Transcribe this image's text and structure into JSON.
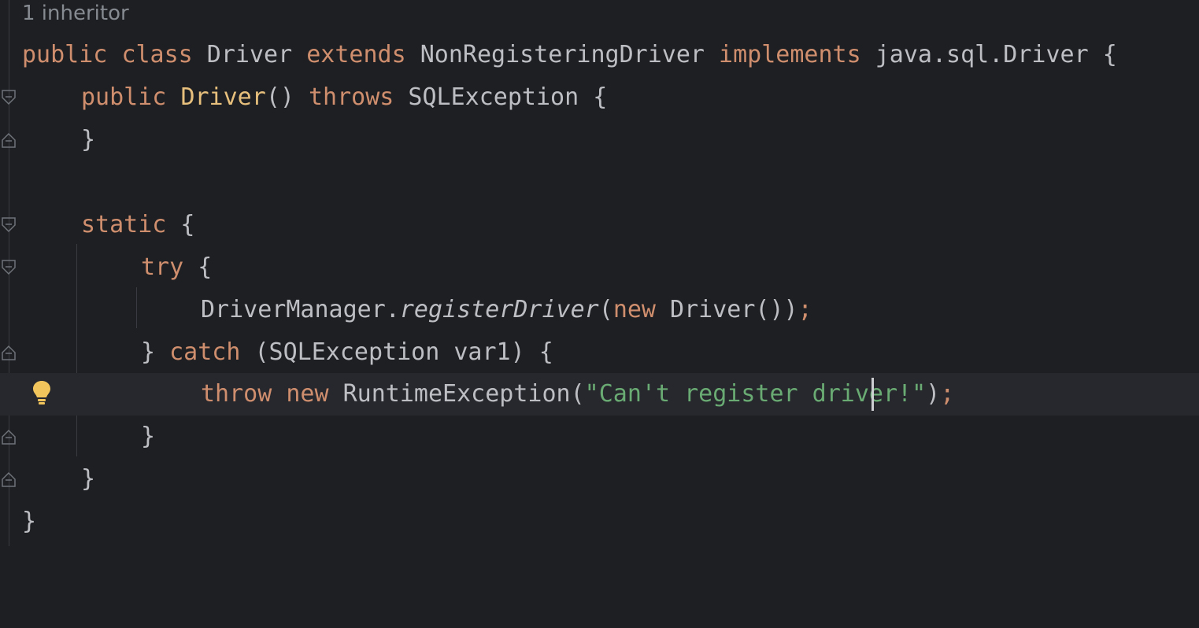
{
  "editor": {
    "hint": "1 inheritor",
    "lines": {
      "l1": {
        "a": "public",
        "b": " ",
        "c": "class",
        "d": " Driver ",
        "e": "extends",
        "f": " NonRegisteringDriver ",
        "g": "implements",
        "h": " java.sql.Driver {"
      },
      "l2": {
        "a": "public",
        "b": " ",
        "c": "Driver",
        "d": "() ",
        "e": "throws",
        "f": " SQLException {"
      },
      "l3": {
        "a": "}"
      },
      "l4": {
        "a": "static",
        "b": " {"
      },
      "l5": {
        "a": "try",
        "b": " {"
      },
      "l6": {
        "a": "DriverManager.",
        "b": "registerDriver",
        "c": "(",
        "d": "new",
        "e": " Driver())",
        "f": ";"
      },
      "l7": {
        "a": "} ",
        "b": "catch",
        "c": " (SQLException var1) {"
      },
      "l8": {
        "a": "throw",
        "b": " ",
        "c": "new",
        "d": " RuntimeException(",
        "e": "\"Can't register driver!\"",
        "f": ")",
        "g": ";"
      },
      "l9": {
        "a": "}"
      },
      "l10": {
        "a": "}"
      },
      "l11": {
        "a": "}"
      }
    }
  }
}
